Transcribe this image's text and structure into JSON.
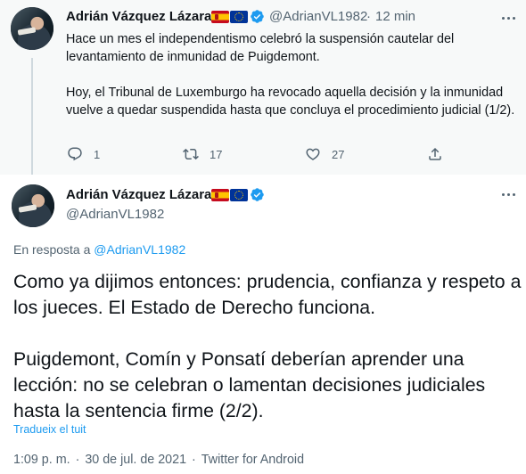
{
  "parent_tweet": {
    "author_name": "Adrián Vázquez Lázara",
    "handle": "@AdrianVL1982",
    "time": "12 min",
    "paragraph_1": "Hace un mes el independentismo celebró la suspensión cautelar del levantamiento de inmunidad de Puigdemont.",
    "paragraph_2": "Hoy, el Tribunal de Luxemburgo ha revocado aquella decisión y la inmunidad vuelve a quedar suspendida hasta que concluya el procedimiento judicial (1/2).",
    "replies": "1",
    "retweets": "17",
    "likes": "27"
  },
  "main_tweet": {
    "author_name": "Adrián Vázquez Lázara",
    "handle": "@AdrianVL1982",
    "reply_to_label": "En resposta a",
    "reply_to_handle": "@AdrianVL1982",
    "paragraph_1": "Como ya dijimos entonces: prudencia, confianza y respeto a los jueces. El Estado de Derecho funciona.",
    "paragraph_2": "Puigdemont, Comín y Ponsatí deberían aprender una lección: no se celebran o lamentan decisiones judiciales hasta la sentencia firme (2/2).",
    "translate_link": "Tradueix el tuit",
    "time": "1:09 p. m.",
    "date": "30 de jul. de 2021",
    "source": "Twitter for Android",
    "separator": "·"
  },
  "icons": {
    "reply": "reply-icon",
    "retweet": "retweet-icon",
    "like": "heart-icon",
    "share": "share-icon",
    "verified": "verified-badge-icon",
    "more": "more-options-icon",
    "flags": [
      "spain-flag-icon",
      "eu-flag-icon"
    ]
  },
  "colors": {
    "accent": "#1d9bf0",
    "muted_text": "#536471",
    "parent_background": "#f7f9f9"
  }
}
